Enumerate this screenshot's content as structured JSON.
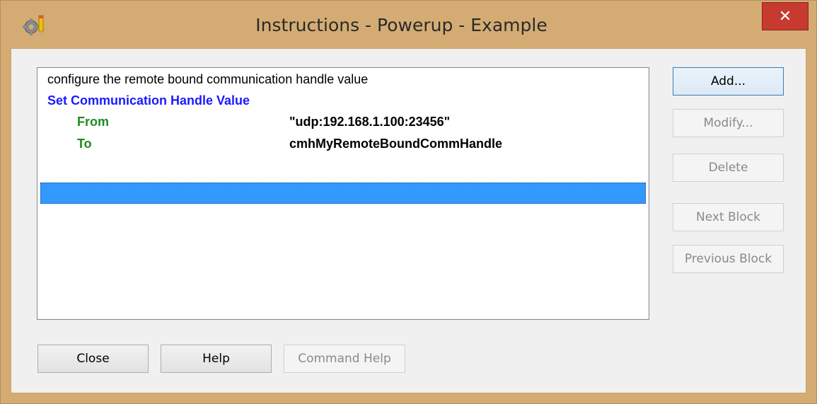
{
  "window": {
    "title": "Instructions - Powerup - Example",
    "close_glyph": "✕"
  },
  "list": {
    "comment": "configure the remote bound communication handle value",
    "command": "Set Communication Handle Value",
    "params": [
      {
        "name": "From",
        "value": "\"udp:192.168.1.100:23456\""
      },
      {
        "name": "To",
        "value": "cmhMyRemoteBoundCommHandle"
      }
    ]
  },
  "buttons": {
    "add": "Add...",
    "modify": "Modify...",
    "delete": "Delete",
    "next_block": "Next Block",
    "previous_block": "Previous Block",
    "close": "Close",
    "help": "Help",
    "command_help": "Command Help"
  },
  "colors": {
    "command": "#1a1aff",
    "param_name": "#1e8c1e",
    "selection": "#3399ff",
    "titlebar": "#d4ac73",
    "close_button": "#c73a2f"
  },
  "icons": {
    "app": "gear-pencil-icon"
  }
}
